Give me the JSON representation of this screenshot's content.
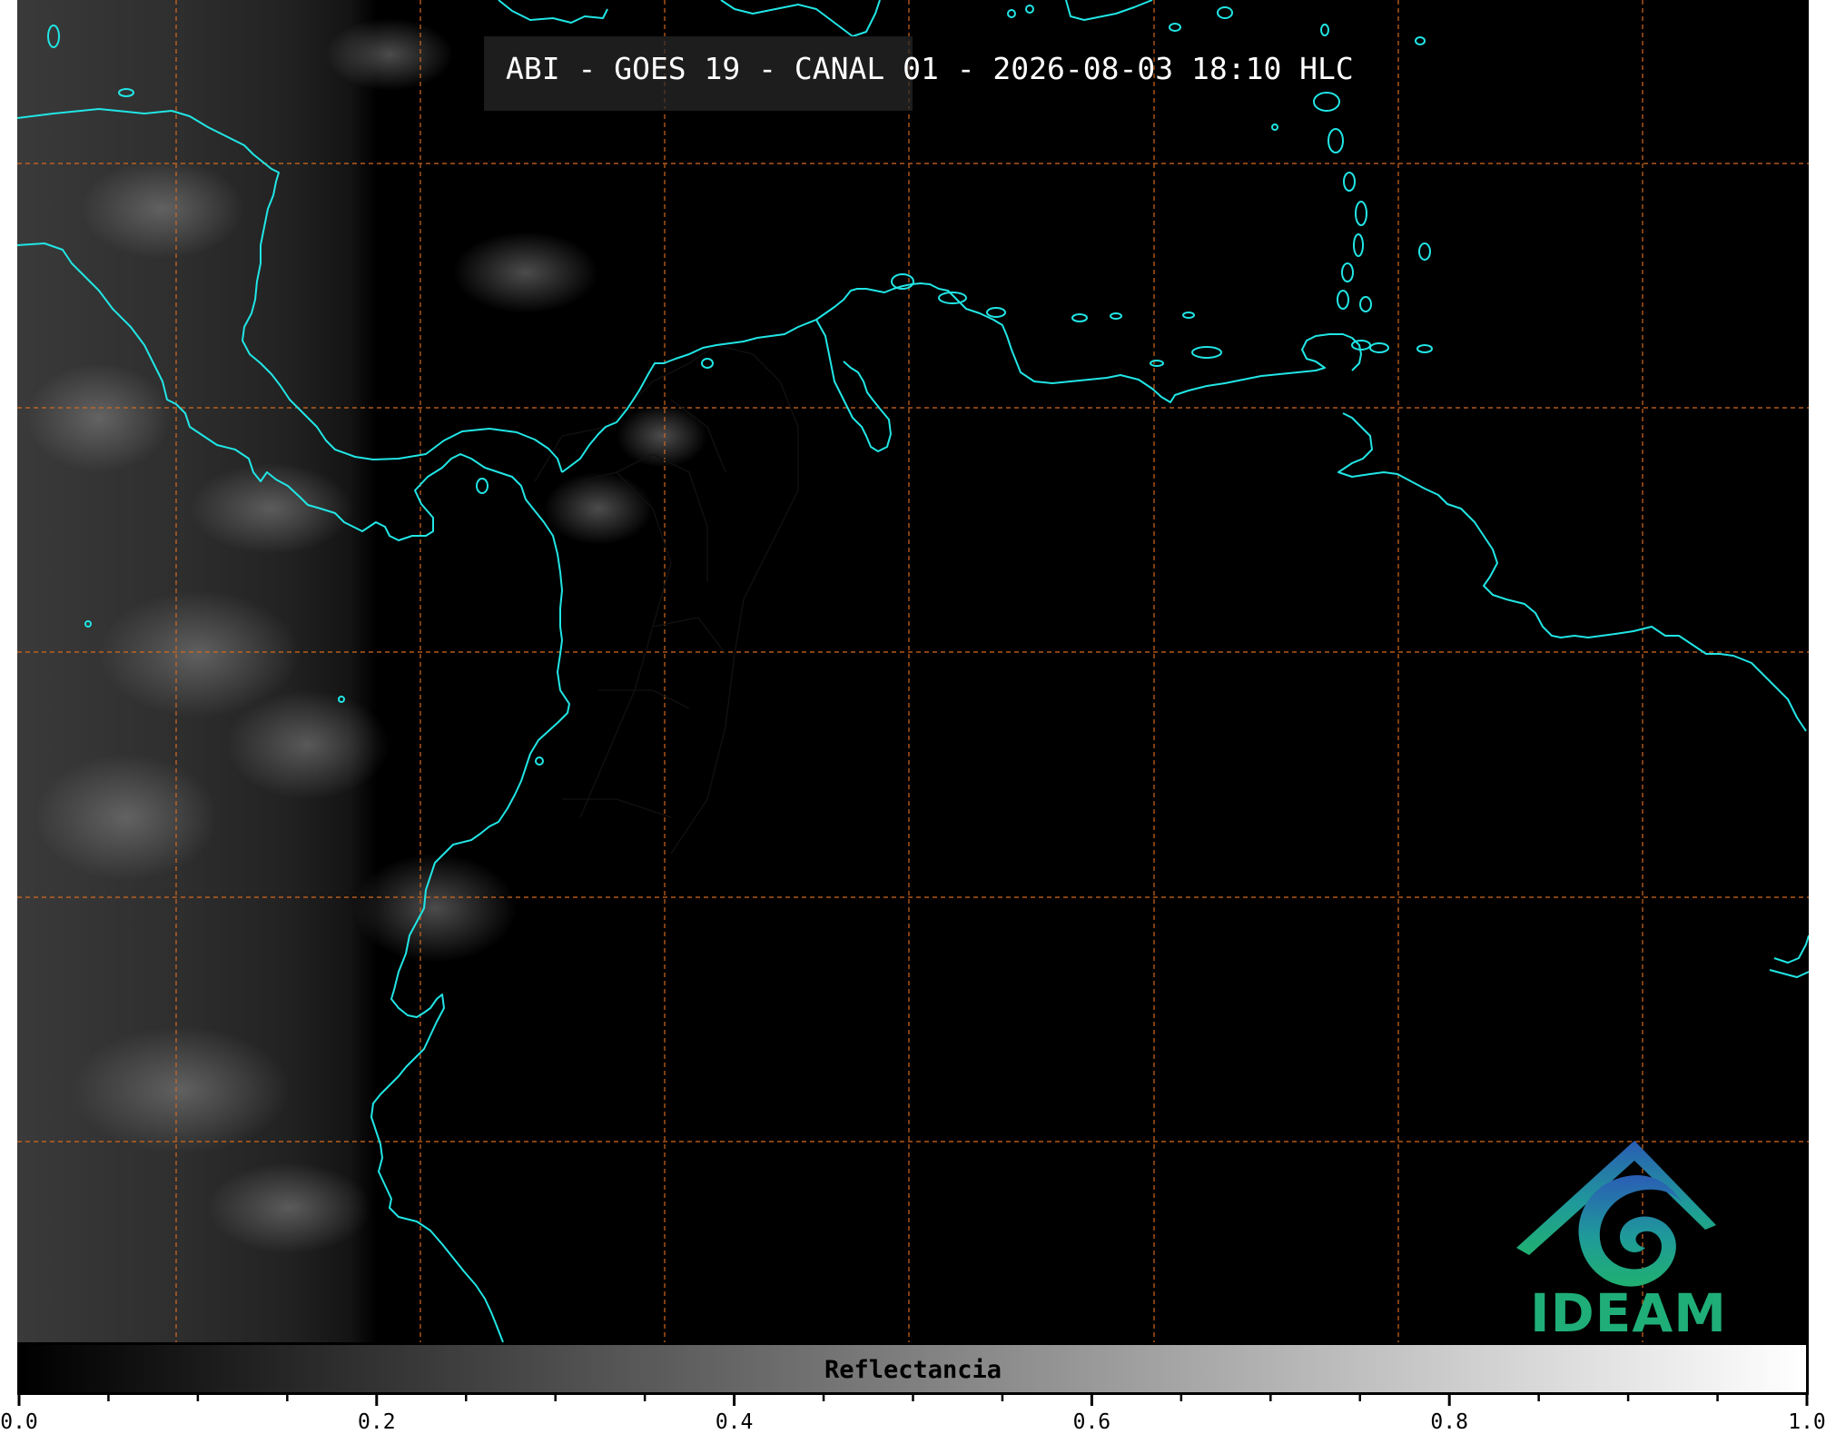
{
  "map": {
    "title": "ABI - GOES 19 - CANAL 01 - 2026-08-03 18:10 HLC",
    "colors": {
      "coastline": "#22e5e5",
      "gridline": "#d2691e",
      "borders": "#111111",
      "background": "#000000"
    },
    "logo": {
      "text": "IDEAM",
      "color": "#1fae78"
    }
  },
  "colorbar": {
    "label": "Reflectancia",
    "range": [
      0.0,
      1.0
    ],
    "colormap": "gray",
    "major_ticks": [
      "0.0",
      "0.2",
      "0.4",
      "0.6",
      "0.8",
      "1.0"
    ],
    "minor_step": 0.05
  }
}
